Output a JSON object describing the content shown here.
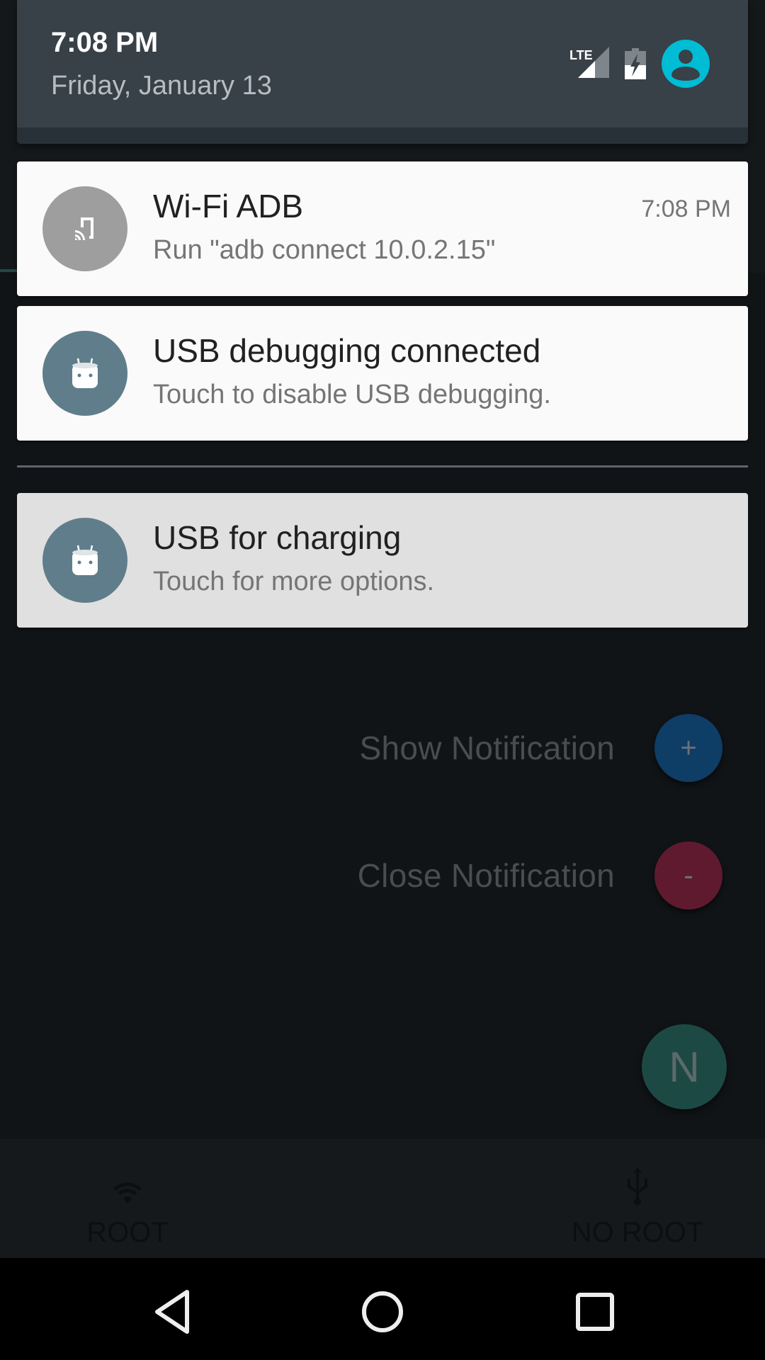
{
  "status_header": {
    "time": "7:08 PM",
    "date": "Friday, January 13",
    "icons": [
      "lte-signal-icon",
      "battery-charging-icon",
      "user-avatar-icon"
    ],
    "network_label": "LTE",
    "avatar_color": "#00bcd4"
  },
  "notifications": [
    {
      "title": "Wi-Fi ADB",
      "text": "Run \"adb connect 10.0.2.15\"",
      "time": "7:08 PM",
      "icon": "cast-phone-icon",
      "icon_color": "#9e9e9e"
    },
    {
      "title": "USB debugging connected",
      "text": "Touch to disable USB debugging.",
      "icon": "android-marshmallow-icon",
      "icon_color": "#607d8b"
    },
    {
      "title": "USB for charging",
      "text": "Touch for more options.",
      "icon": "android-marshmallow-icon",
      "icon_color": "#607d8b"
    }
  ],
  "app": {
    "show_notification_label": "Show Notification",
    "show_notification_symbol": "+",
    "close_notification_label": "Close Notification",
    "close_notification_symbol": "-",
    "fab_letter": "N",
    "tabs": [
      {
        "label": "ROOT",
        "icon": "wifi-icon"
      },
      {
        "label": "NO ROOT",
        "icon": "usb-icon"
      }
    ]
  },
  "navbar": {
    "buttons": [
      "back",
      "home",
      "recents"
    ]
  }
}
